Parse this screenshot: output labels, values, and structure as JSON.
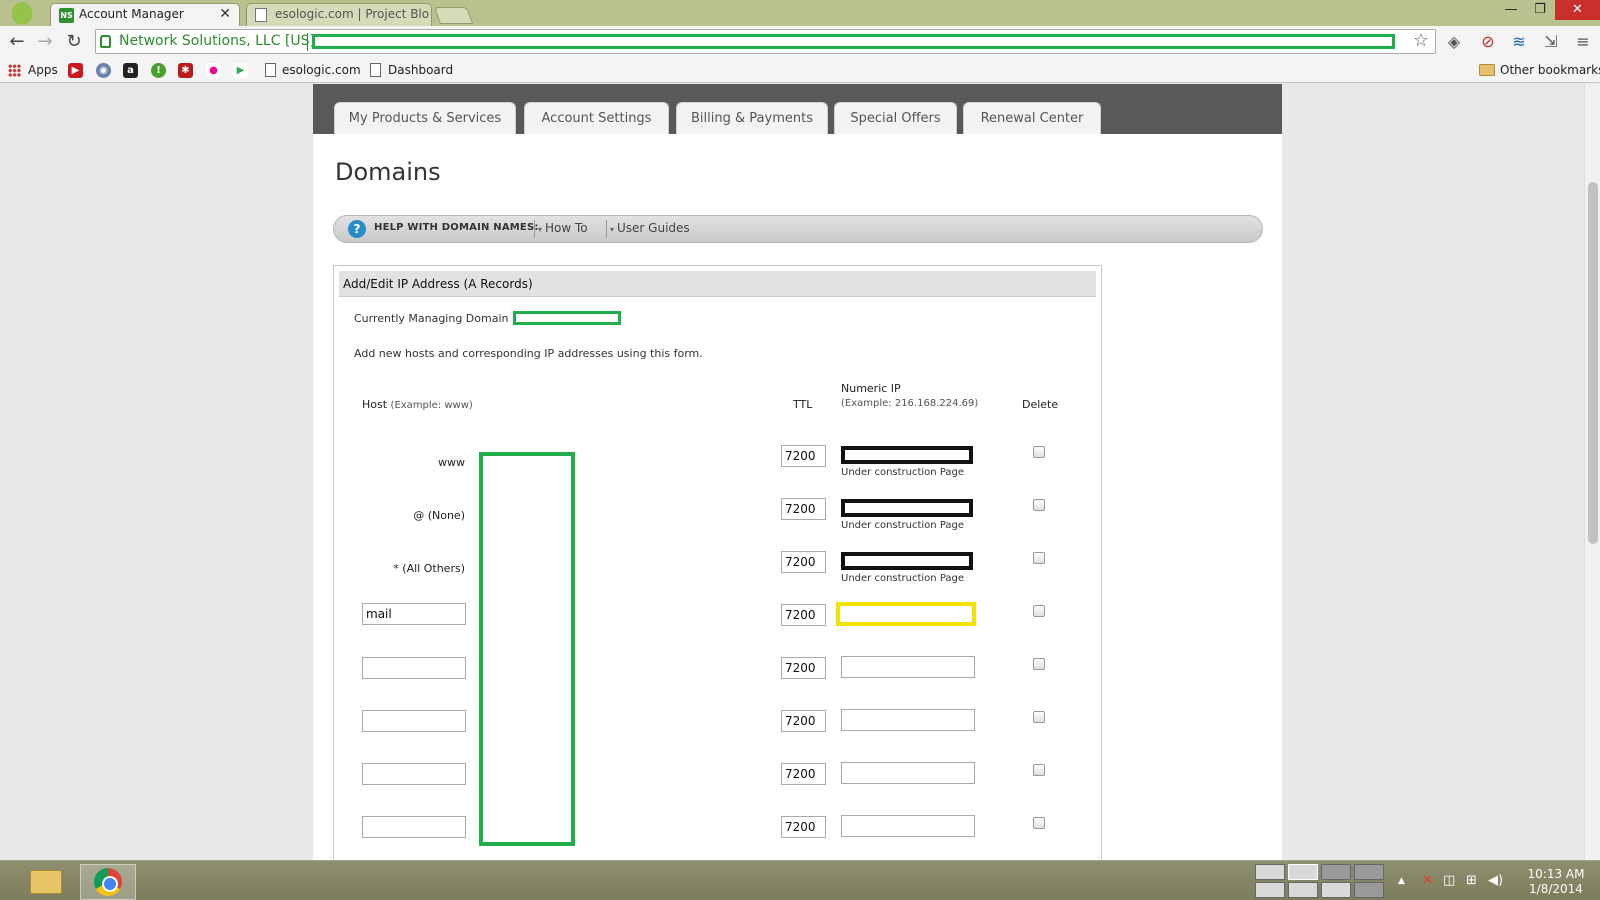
{
  "browser": {
    "tabs": [
      {
        "title": "Account Manager",
        "active": true
      },
      {
        "title": "esologic.com | Project Blo",
        "active": false
      }
    ],
    "tab_close": "✕",
    "window_controls": {
      "minimize": "—",
      "restore": "❐",
      "close": "✕"
    },
    "nav": {
      "back": "←",
      "forward": "→",
      "reload": "↻"
    },
    "address_bar": {
      "ev_label": "Network Solutions, LLC [US]",
      "star": "☆"
    },
    "extensions": [
      "◈",
      "⊘",
      "≋",
      "⇲",
      "≡"
    ],
    "bookmarks": [
      {
        "label": "Apps"
      },
      {
        "label": "esologic.com"
      },
      {
        "label": "Dashboard"
      }
    ],
    "other_bookmarks": "Other bookmarks",
    "bookmark_icons": [
      {
        "name": "youtube-icon",
        "color": "#cc181e",
        "glyph": "▶"
      },
      {
        "name": "reddit-icon",
        "color": "#6a7fa8",
        "glyph": "◉"
      },
      {
        "name": "amazon-icon",
        "color": "#222222",
        "glyph": "a"
      },
      {
        "name": "green-alert-icon",
        "color": "#4aa02c",
        "glyph": "!"
      },
      {
        "name": "lastpass-icon",
        "color": "#b91c1c",
        "glyph": "✱"
      },
      {
        "name": "flickr-icon",
        "color": "#ff0084",
        "glyph": "●"
      },
      {
        "name": "play-store-icon",
        "color": "#3ba55c",
        "glyph": "▶"
      }
    ]
  },
  "page": {
    "nav_tabs": [
      "My Products & Services",
      "Account Settings",
      "Billing & Payments",
      "Special Offers",
      "Renewal Center"
    ],
    "heading": "Domains",
    "help": {
      "icon": "?",
      "label": "HELP WITH DOMAIN NAMES:",
      "menus": [
        "How To",
        "User Guides"
      ],
      "caret": "▾"
    },
    "panel": {
      "title": "Add/Edit IP Address (A Records)",
      "current_domain_label": "Currently Managing Domain :",
      "intro": "Add new hosts and corresponding IP addresses using this form.",
      "columns": {
        "host": "Host",
        "host_example": "(Example: www)",
        "ttl": "TTL",
        "ip": "Numeric IP",
        "ip_example": "(Example: 216.168.224.69)",
        "delete": "Delete"
      },
      "records": [
        {
          "host_label": "www",
          "ttl": "7200",
          "note": "Under construction Page"
        },
        {
          "host_label": "@ (None)",
          "ttl": "7200",
          "note": "Under construction Page"
        },
        {
          "host_label": "* (All Others)",
          "ttl": "7200",
          "note": "Under construction Page"
        },
        {
          "host_value": "mail",
          "ttl": "7200"
        },
        {
          "host_value": "",
          "ttl": "7200"
        },
        {
          "host_value": "",
          "ttl": "7200"
        },
        {
          "host_value": "",
          "ttl": "7200"
        },
        {
          "host_value": "",
          "ttl": "7200"
        }
      ]
    }
  },
  "taskbar": {
    "time": "10:13 AM",
    "date": "1/8/2014",
    "tray_icons": [
      "▲",
      "✕",
      "◫",
      "⊞",
      "◀)"
    ]
  },
  "colors": {
    "redaction_green": "#1fae4b",
    "highlight_yellow": "#f2e400",
    "ev_green": "#2e8b2e",
    "nav_band": "#595959"
  }
}
